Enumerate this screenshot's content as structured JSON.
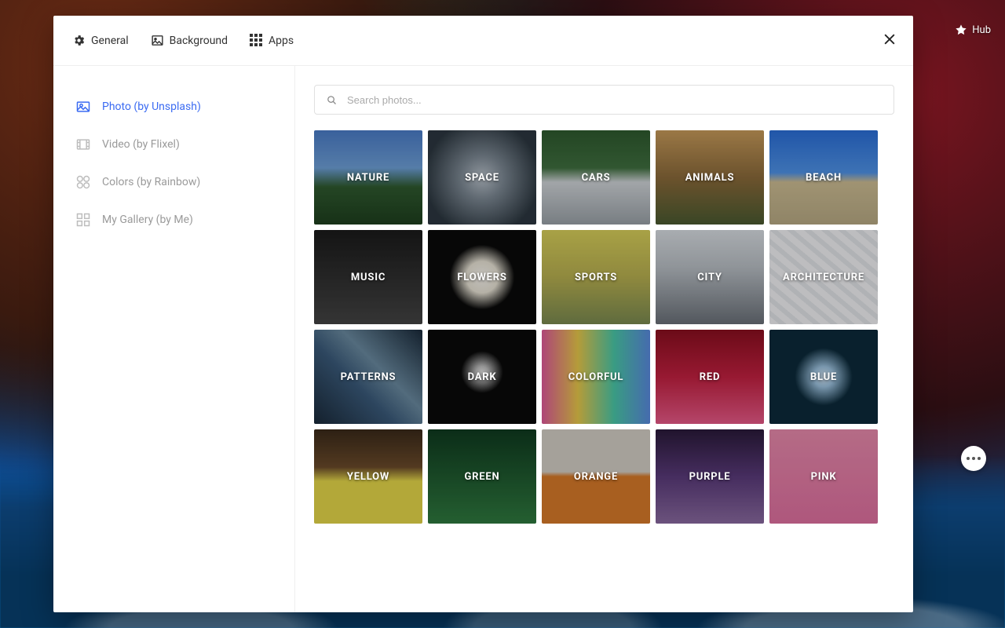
{
  "desktop": {
    "hub_label": "Hub"
  },
  "modal": {
    "tabs": {
      "general": "General",
      "background": "Background",
      "apps": "Apps"
    },
    "sidebar": {
      "items": [
        {
          "label": "Photo (by Unsplash)"
        },
        {
          "label": "Video (by Flixel)"
        },
        {
          "label": "Colors (by Rainbow)"
        },
        {
          "label": "My Gallery (by Me)"
        }
      ]
    },
    "search": {
      "placeholder": "Search photos...",
      "value": ""
    },
    "categories": [
      {
        "label": "NATURE",
        "class": "t-nature"
      },
      {
        "label": "SPACE",
        "class": "t-space"
      },
      {
        "label": "CARS",
        "class": "t-cars"
      },
      {
        "label": "ANIMALS",
        "class": "t-animals"
      },
      {
        "label": "BEACH",
        "class": "t-beach"
      },
      {
        "label": "MUSIC",
        "class": "t-music"
      },
      {
        "label": "FLOWERS",
        "class": "t-flowers"
      },
      {
        "label": "SPORTS",
        "class": "t-sports"
      },
      {
        "label": "CITY",
        "class": "t-city"
      },
      {
        "label": "ARCHITECTURE",
        "class": "t-architecture"
      },
      {
        "label": "PATTERNS",
        "class": "t-patterns"
      },
      {
        "label": "DARK",
        "class": "t-dark"
      },
      {
        "label": "COLORFUL",
        "class": "t-colorful"
      },
      {
        "label": "RED",
        "class": "t-red"
      },
      {
        "label": "BLUE",
        "class": "t-blue"
      },
      {
        "label": "YELLOW",
        "class": "t-yellow"
      },
      {
        "label": "GREEN",
        "class": "t-green"
      },
      {
        "label": "ORANGE",
        "class": "t-orange"
      },
      {
        "label": "PURPLE",
        "class": "t-purple"
      },
      {
        "label": "PINK",
        "class": "t-pink"
      }
    ]
  }
}
